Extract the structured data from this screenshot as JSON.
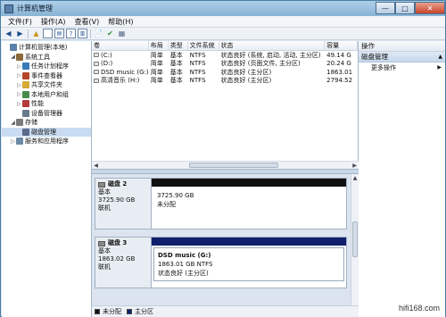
{
  "window": {
    "title": "计算机管理",
    "min": "—",
    "max": "□",
    "close": "✕"
  },
  "menu": [
    "文件(F)",
    "操作(A)",
    "查看(V)",
    "帮助(H)"
  ],
  "tree": [
    {
      "label": "计算机管理(本地)",
      "indent": 0,
      "twisty": "",
      "icon": "#5a7fa8",
      "name": "computer-management-icon"
    },
    {
      "label": "系统工具",
      "indent": 1,
      "twisty": "◢",
      "icon": "#8a6a3a",
      "name": "system-tools-icon"
    },
    {
      "label": "任务计划程序",
      "indent": 2,
      "twisty": "▷",
      "icon": "#3a7ab8",
      "name": "task-scheduler-icon"
    },
    {
      "label": "事件查看器",
      "indent": 2,
      "twisty": "▷",
      "icon": "#b5462a",
      "name": "event-viewer-icon"
    },
    {
      "label": "共享文件夹",
      "indent": 2,
      "twisty": "▷",
      "icon": "#d4a934",
      "name": "shared-folder-icon"
    },
    {
      "label": "本地用户和组",
      "indent": 2,
      "twisty": "▷",
      "icon": "#4a8a4a",
      "name": "users-icon"
    },
    {
      "label": "性能",
      "indent": 2,
      "twisty": "▷",
      "icon": "#b53a3a",
      "name": "performance-icon"
    },
    {
      "label": "设备管理器",
      "indent": 2,
      "twisty": "",
      "icon": "#6a7a8a",
      "name": "device-manager-icon"
    },
    {
      "label": "存储",
      "indent": 1,
      "twisty": "◢",
      "icon": "#7a7a7a",
      "name": "storage-icon"
    },
    {
      "label": "磁盘管理",
      "indent": 2,
      "twisty": "",
      "icon": "#5a6a8a",
      "name": "disk-management-icon",
      "selected": true
    },
    {
      "label": "服务和应用程序",
      "indent": 1,
      "twisty": "▷",
      "icon": "#6a8aa8",
      "name": "services-apps-icon"
    }
  ],
  "volume_columns": [
    "卷",
    "布局",
    "类型",
    "文件系统",
    "状态",
    "容量"
  ],
  "volumes": [
    [
      "(C:)",
      "简单",
      "基本",
      "NTFS",
      "状态良好 (系统, 启动, 活动, 主分区)",
      "49.14 G"
    ],
    [
      "(D:)",
      "简单",
      "基本",
      "NTFS",
      "状态良好 (页面文件, 主分区)",
      "20.24 G"
    ],
    [
      "DSD music (G:)",
      "简单",
      "基本",
      "NTFS",
      "状态良好 (主分区)",
      "1863.01"
    ],
    [
      "高清音乐 (H:)",
      "简单",
      "基本",
      "NTFS",
      "状态良好 (主分区)",
      "2794.52"
    ]
  ],
  "disks": [
    {
      "name": "磁盘 2",
      "type": "基本",
      "size": "3725.90 GB",
      "status": "联机",
      "bar": "black",
      "part_title": "",
      "part_size": "3725.90 GB",
      "part_status": "未分配"
    },
    {
      "name": "磁盘 3",
      "type": "基本",
      "size": "1863.02 GB",
      "status": "联机",
      "bar": "blue",
      "part_title": "DSD music  (G:)",
      "part_size": "1863.01 GB NTFS",
      "part_status": "状态良好 (主分区)"
    }
  ],
  "legend": {
    "unallocated": "未分配",
    "primary": "主分区",
    "unallocated_color": "#111111",
    "primary_color": "#0f1f6e"
  },
  "actions": {
    "header": "操作",
    "section": "磁盘管理",
    "section_arrow": "▲",
    "more": "更多操作",
    "more_arrow": "▶"
  },
  "watermark": "hifi168.com"
}
